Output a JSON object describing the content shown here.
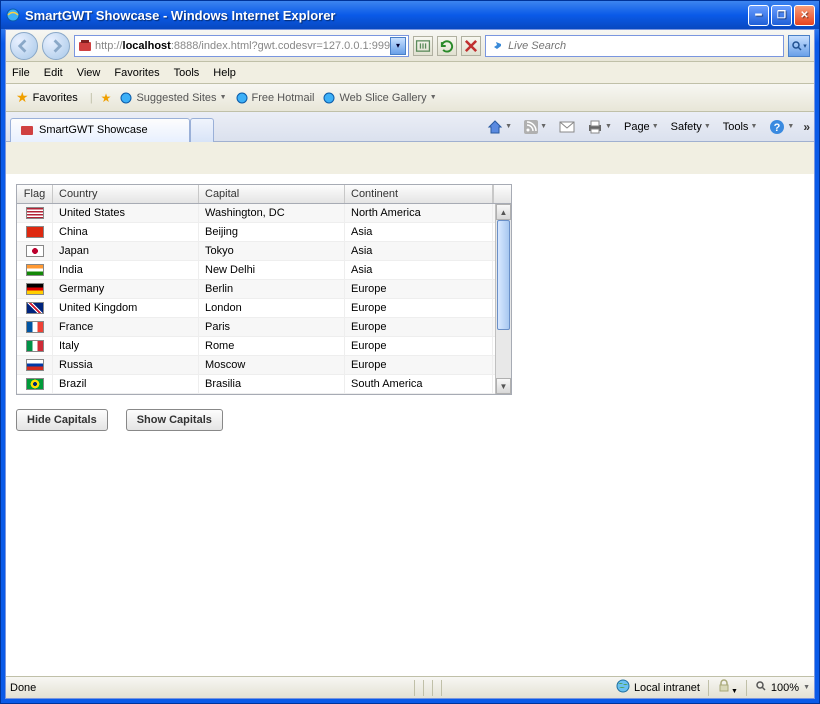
{
  "window": {
    "title": "SmartGWT Showcase - Windows Internet Explorer"
  },
  "nav": {
    "url_prefix": "http://",
    "url_host": "localhost",
    "url_port_path": ":8888/index.html?gwt.codesvr=127.0.0.1:999",
    "search_placeholder": "Live Search"
  },
  "menu": {
    "file": "File",
    "edit": "Edit",
    "view": "View",
    "favorites": "Favorites",
    "tools": "Tools",
    "help": "Help"
  },
  "favbar": {
    "favorites_btn": "Favorites",
    "suggested": "Suggested Sites",
    "hotmail": "Free Hotmail",
    "webslice": "Web Slice Gallery"
  },
  "tabs": {
    "active": "SmartGWT Showcase"
  },
  "toolbar": {
    "page": "Page",
    "safety": "Safety",
    "tools": "Tools"
  },
  "grid": {
    "headers": {
      "flag": "Flag",
      "country": "Country",
      "capital": "Capital",
      "continent": "Continent"
    },
    "rows": [
      {
        "flag": "us",
        "country": "United States",
        "capital": "Washington, DC",
        "continent": "North America"
      },
      {
        "flag": "cn",
        "country": "China",
        "capital": "Beijing",
        "continent": "Asia"
      },
      {
        "flag": "jp",
        "country": "Japan",
        "capital": "Tokyo",
        "continent": "Asia"
      },
      {
        "flag": "in",
        "country": "India",
        "capital": "New Delhi",
        "continent": "Asia"
      },
      {
        "flag": "de",
        "country": "Germany",
        "capital": "Berlin",
        "continent": "Europe"
      },
      {
        "flag": "gb",
        "country": "United Kingdom",
        "capital": "London",
        "continent": "Europe"
      },
      {
        "flag": "fr",
        "country": "France",
        "capital": "Paris",
        "continent": "Europe"
      },
      {
        "flag": "it",
        "country": "Italy",
        "capital": "Rome",
        "continent": "Europe"
      },
      {
        "flag": "ru",
        "country": "Russia",
        "capital": "Moscow",
        "continent": "Europe"
      },
      {
        "flag": "br",
        "country": "Brazil",
        "capital": "Brasilia",
        "continent": "South America"
      }
    ]
  },
  "buttons": {
    "hide": "Hide Capitals",
    "show": "Show Capitals"
  },
  "status": {
    "left": "Done",
    "zone": "Local intranet",
    "zoom": "100%"
  },
  "flag_colors": {
    "us": "linear-gradient(to bottom, #b22234 0%, #b22234 15%, white 15%, white 30%, #b22234 30%, #b22234 45%, white 45%, white 60%, #b22234 60%, #b22234 75%, white 75%, white 90%, #b22234 90%)",
    "cn": "#de2910",
    "jp": "radial-gradient(circle at center, #bc002d 0%, #bc002d 30%, white 32%)",
    "in": "linear-gradient(to bottom, #ff9933 0%, #ff9933 33%, white 33%, white 66%, #138808 66%)",
    "de": "linear-gradient(to bottom, black 0%, black 33%, #dd0000 33%, #dd0000 66%, #ffce00 66%)",
    "gb": "linear-gradient(45deg, #00247d 40%, white 40%, white 45%, #cf142b 45%, #cf142b 55%, white 55%, white 60%, #00247d 60%)",
    "fr": "linear-gradient(to right, #0055a4 0%, #0055a4 33%, white 33%, white 66%, #ef4135 66%)",
    "it": "linear-gradient(to right, #009246 0%, #009246 33%, white 33%, white 66%, #ce2b37 66%)",
    "ru": "linear-gradient(to bottom, white 0%, white 33%, #0039a6 33%, #0039a6 66%, #d52b1e 66%)",
    "br": "radial-gradient(circle at center, #002776 0%, #002776 20%, #fedf00 22%, #fedf00 45%, #009b3a 47%)"
  }
}
